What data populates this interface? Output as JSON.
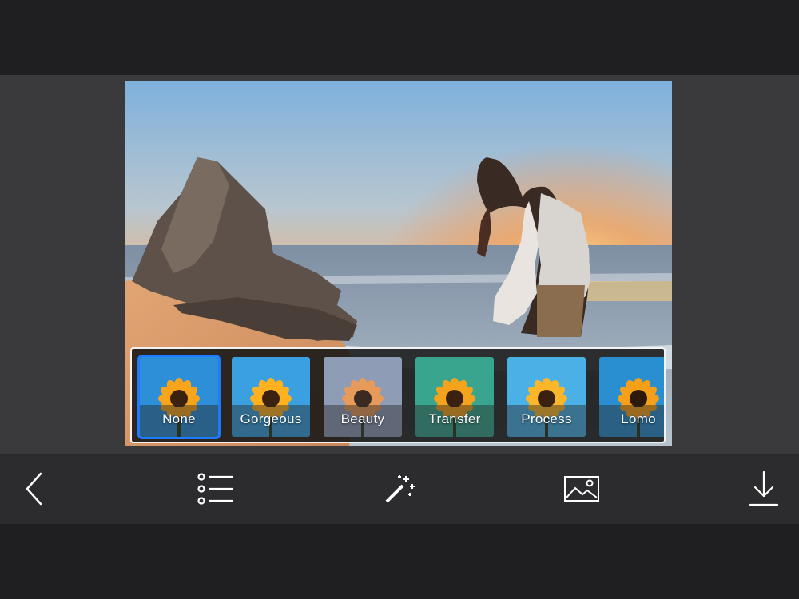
{
  "filters": {
    "items": [
      {
        "label": "None",
        "selected": true,
        "tint": "#2d8fd8"
      },
      {
        "label": "Gorgeous",
        "selected": false,
        "tint": "#3aa0e0"
      },
      {
        "label": "Beauty",
        "selected": false,
        "tint": "#8f9cb6"
      },
      {
        "label": "Transfer",
        "selected": false,
        "tint": "#3aa58f"
      },
      {
        "label": "Process",
        "selected": false,
        "tint": "#4ab0e6"
      },
      {
        "label": "Lomo",
        "selected": false,
        "tint": "#2a8fd0"
      }
    ]
  },
  "toolbar": {
    "back_icon": "chevron-left-icon",
    "list_icon": "list-icon",
    "effects_icon": "magic-wand-icon",
    "gallery_icon": "image-icon",
    "download_icon": "download-icon"
  },
  "colors": {
    "accent": "#1e7bff",
    "toolbar_bg": "#2c2c2e",
    "editor_bg": "#3a3a3c"
  }
}
